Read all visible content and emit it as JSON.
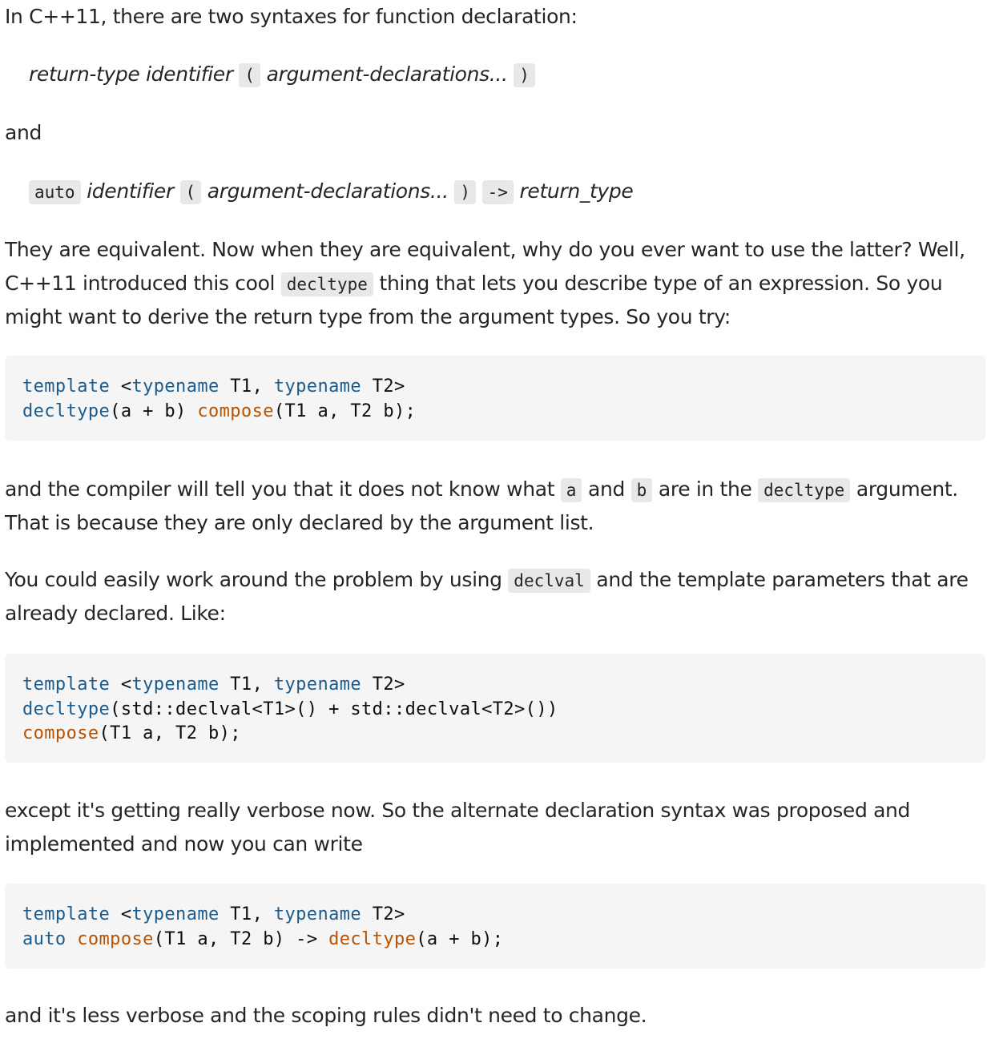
{
  "intro": "In C++11, there are two syntaxes for function declaration:",
  "syntax1": {
    "return_type": "return-type",
    "identifier": "identifier",
    "lparen": "(",
    "args": "argument-declarations...",
    "rparen": ")"
  },
  "and": "and",
  "syntax2": {
    "auto": "auto",
    "identifier": "identifier",
    "lparen": "(",
    "args": "argument-declarations...",
    "rparen": ")",
    "arrow": "->",
    "return_type": "return_type"
  },
  "para1": {
    "line1": "They are equivalent. Now when they are equivalent, why do you ever want to use the latter? Well,",
    "line2a": "C++11 introduced this cool ",
    "decltype": "decltype",
    "line2b": " thing that lets you describe type of an expression. So you",
    "line3": "might want to derive the return type from the argument types. So you try:"
  },
  "code1": {
    "template": "template",
    "typename": "typename",
    "l1_open": " <",
    "l1_mid": " T1, ",
    "l1_end": " T2>",
    "decltype": "decltype",
    "l2_a": "(a + b) ",
    "compose": "compose",
    "l2_b": "(T1 a, T2 b);"
  },
  "para2": {
    "a1": "and the compiler will tell you that it does not know what ",
    "code_a": "a",
    "a2": " and ",
    "code_b": "b",
    "a3": " are in the ",
    "decltype": "decltype",
    "a4": " argument.",
    "line2": "That is because they are only declared by the argument list."
  },
  "para3": {
    "a1": "You could easily work around the problem by using ",
    "declval": "declval",
    "a2": " and the template parameters that are",
    "line2": "already declared. Like:"
  },
  "code2": {
    "template": "template",
    "typename": "typename",
    "l1_open": " <",
    "l1_mid": " T1, ",
    "l1_end": " T2>",
    "decltype": "decltype",
    "l2_rest": "(std::declval<T1>() + std::declval<T2>())",
    "compose": "compose",
    "l3_rest": "(T1 a, T2 b);"
  },
  "para4": {
    "line1": "except it's getting really verbose now. So the alternate declaration syntax was proposed and",
    "line2": "implemented and now you can write"
  },
  "code3": {
    "template": "template",
    "typename": "typename",
    "l1_open": " <",
    "l1_mid": " T1, ",
    "l1_end": " T2>",
    "auto": "auto",
    "compose": "compose",
    "l2_mid": "(T1 a, T2 b) -> ",
    "decltype": "decltype",
    "l2_end": "(a + b);"
  },
  "outro": "and it's less verbose and the scoping rules didn't need to change."
}
